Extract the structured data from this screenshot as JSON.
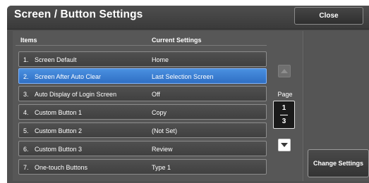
{
  "window": {
    "title": "Screen / Button Settings",
    "close_label": "Close"
  },
  "list": {
    "col_items": "Items",
    "col_current": "Current Settings",
    "rows": [
      {
        "num": "1.",
        "label": "Screen Default",
        "value": "Home",
        "selected": false
      },
      {
        "num": "2.",
        "label": "Screen After Auto Clear",
        "value": "Last Selection Screen",
        "selected": true
      },
      {
        "num": "3.",
        "label": "Auto Display of Login Screen",
        "value": "Off",
        "selected": false
      },
      {
        "num": "4.",
        "label": "Custom Button 1",
        "value": "Copy",
        "selected": false
      },
      {
        "num": "5.",
        "label": "Custom Button 2",
        "value": "(Not Set)",
        "selected": false
      },
      {
        "num": "6.",
        "label": "Custom Button 3",
        "value": "Review",
        "selected": false
      },
      {
        "num": "7.",
        "label": "One-touch Buttons",
        "value": "Type 1",
        "selected": false
      }
    ]
  },
  "pager": {
    "label": "Page",
    "current": "1",
    "total": "3",
    "up_icon": "triangle-up-icon",
    "down_icon": "triangle-down-icon"
  },
  "actions": {
    "change_settings_label": "Change Settings"
  },
  "colors": {
    "selected_row": "#3a80d8",
    "panel": "#575757",
    "title_bar": "#444444"
  }
}
